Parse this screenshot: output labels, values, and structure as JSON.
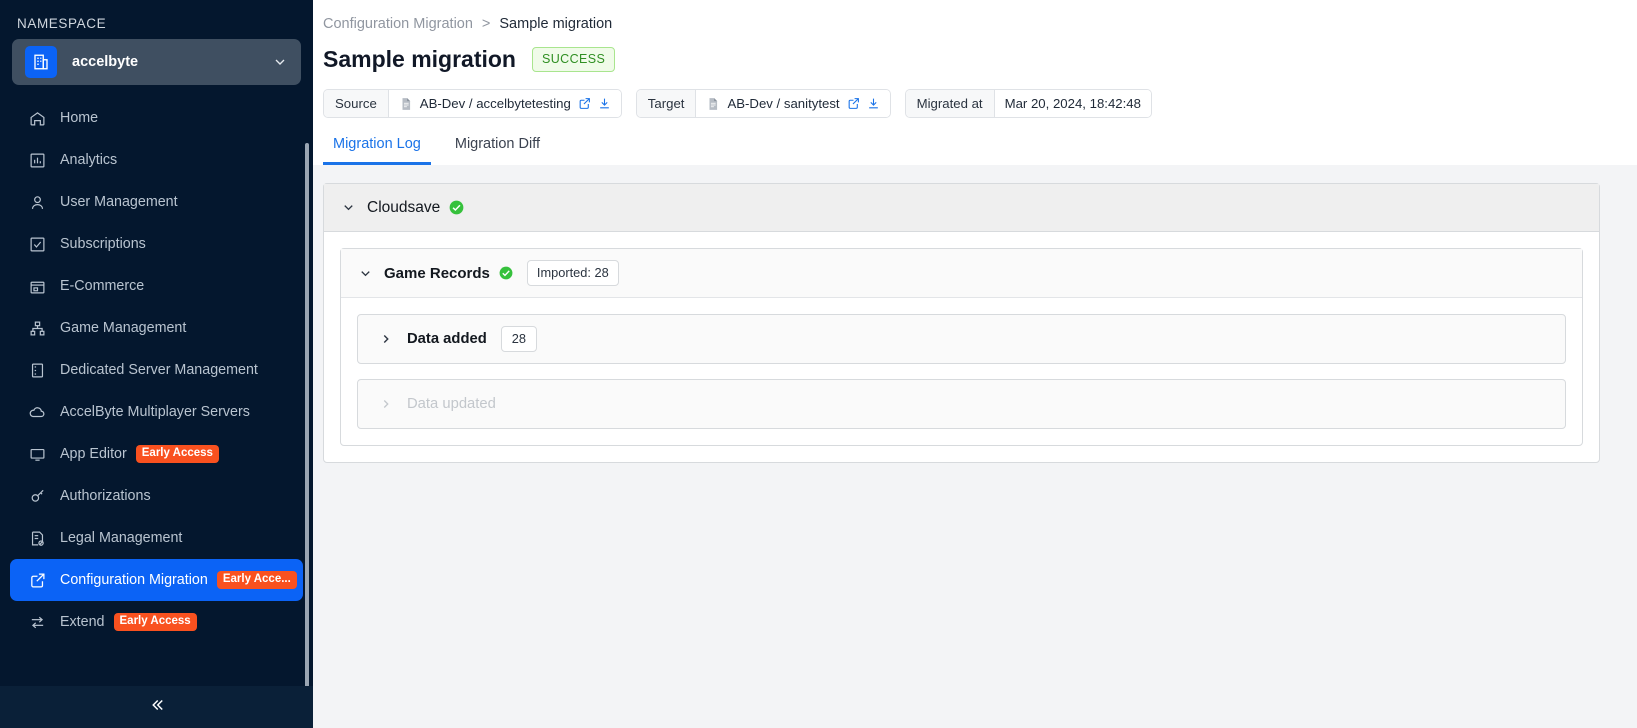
{
  "sidebar": {
    "namespace_label": "NAMESPACE",
    "namespace_value": "accelbyte",
    "items": [
      {
        "label": "Home",
        "icon": "home-icon",
        "badge": null,
        "active": false
      },
      {
        "label": "Analytics",
        "icon": "chart-bar-icon",
        "badge": null,
        "active": false
      },
      {
        "label": "User Management",
        "icon": "user-icon",
        "badge": null,
        "active": false
      },
      {
        "label": "Subscriptions",
        "icon": "checkbox-icon",
        "badge": null,
        "active": false
      },
      {
        "label": "E-Commerce",
        "icon": "store-icon",
        "badge": null,
        "active": false
      },
      {
        "label": "Game Management",
        "icon": "sitemap-icon",
        "badge": null,
        "active": false
      },
      {
        "label": "Dedicated Server Management",
        "icon": "server-icon",
        "badge": null,
        "active": false
      },
      {
        "label": "AccelByte Multiplayer Servers",
        "icon": "cloud-icon",
        "badge": null,
        "active": false
      },
      {
        "label": "App Editor",
        "icon": "monitor-icon",
        "badge": "Early Access",
        "active": false
      },
      {
        "label": "Authorizations",
        "icon": "key-icon",
        "badge": null,
        "active": false
      },
      {
        "label": "Legal Management",
        "icon": "legal-doc-icon",
        "badge": null,
        "active": false
      },
      {
        "label": "Configuration Migration",
        "icon": "external-edit-icon",
        "badge": "Early Acce...",
        "active": true
      },
      {
        "label": "Extend",
        "icon": "extend-icon",
        "badge": "Early Access",
        "active": false
      }
    ],
    "collapse_icon": "double-chevron-left-icon"
  },
  "breadcrumb": {
    "parent": "Configuration Migration",
    "separator": ">",
    "current": "Sample migration"
  },
  "header": {
    "title": "Sample migration",
    "status": "SUCCESS"
  },
  "meta": {
    "source": {
      "key": "Source",
      "value": "AB-Dev / accelbytetesting"
    },
    "target": {
      "key": "Target",
      "value": "AB-Dev / sanitytest"
    },
    "migrated_at": {
      "key": "Migrated at",
      "value": "Mar 20, 2024, 18:42:48"
    }
  },
  "tabs": [
    {
      "label": "Migration Log",
      "active": true
    },
    {
      "label": "Migration Diff",
      "active": false
    }
  ],
  "log": {
    "group": {
      "title": "Cloudsave",
      "status": "success"
    },
    "section": {
      "title": "Game Records",
      "status": "success",
      "pill": "Imported: 28"
    },
    "rows": [
      {
        "label": "Data added",
        "count": "28",
        "disabled": false
      },
      {
        "label": "Data updated",
        "count": "",
        "disabled": true
      }
    ]
  },
  "colors": {
    "accent_blue": "#0b63f6",
    "link_blue": "#1a73e8",
    "early_access_orange": "#f9511f",
    "success_green": "#36c13c",
    "sidebar_bg": "#04172e"
  }
}
